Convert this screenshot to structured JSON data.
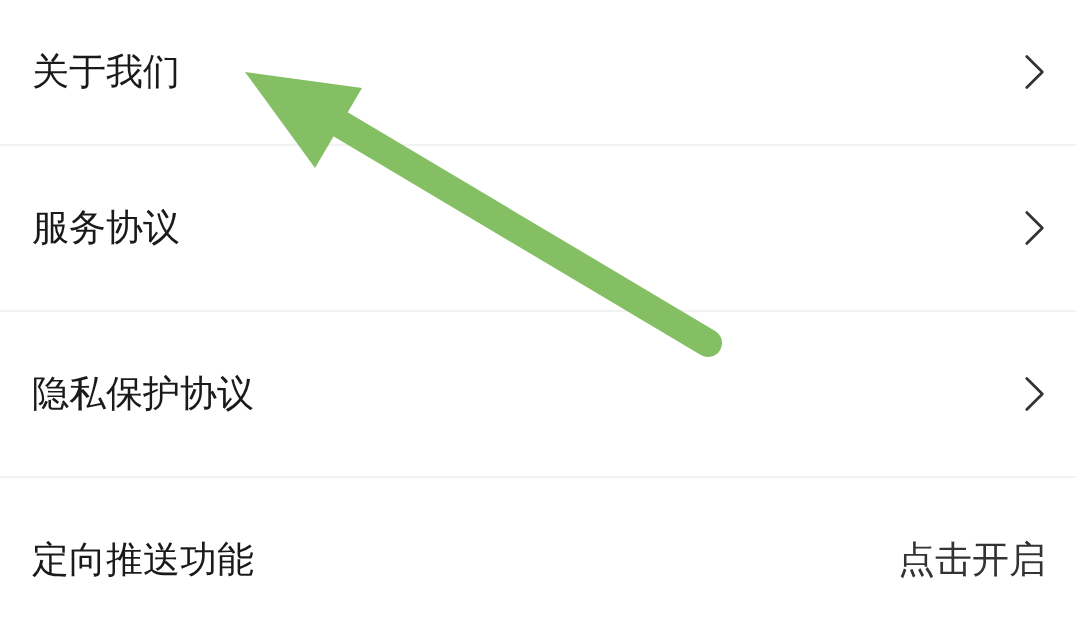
{
  "settings": [
    {
      "kind": "link",
      "label": "关于我们"
    },
    {
      "kind": "link",
      "label": "服务协议"
    },
    {
      "kind": "link",
      "label": "隐私保护协议"
    },
    {
      "kind": "value",
      "label": "定向推送功能",
      "value": "点击开启"
    }
  ]
}
